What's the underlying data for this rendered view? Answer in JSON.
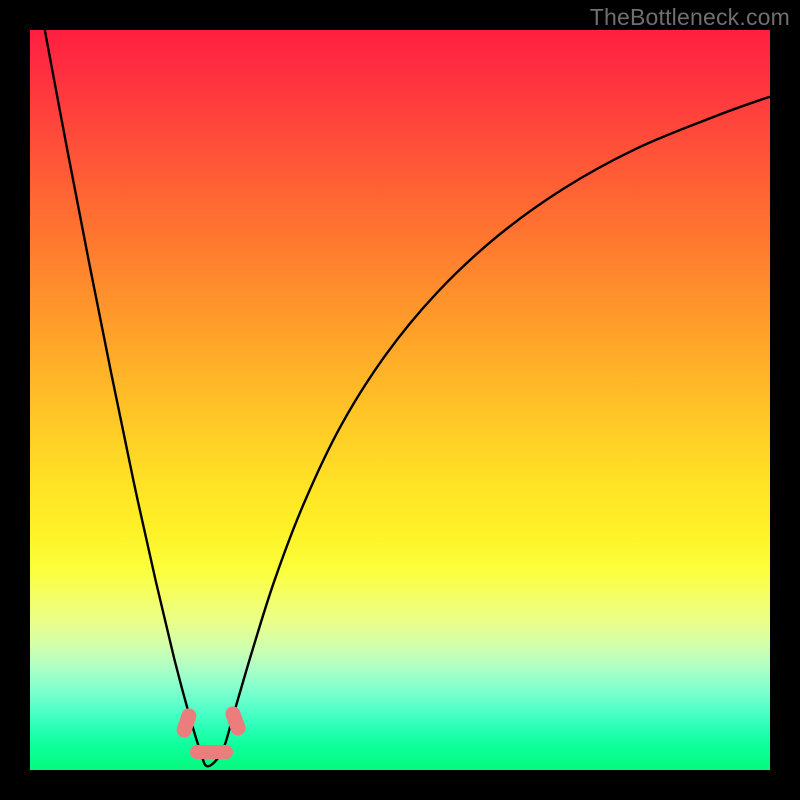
{
  "watermark": "TheBottleneck.com",
  "colors": {
    "frame": "#000000",
    "curve": "#000000",
    "blob": "#eb7d7d",
    "watermark": "#6f6f6f"
  },
  "chart_data": {
    "type": "line",
    "title": "",
    "xlabel": "",
    "ylabel": "",
    "xlim": [
      0,
      100
    ],
    "ylim": [
      0,
      100
    ],
    "grid": false,
    "legend": false,
    "note": "Bottleneck-style V curve. x = normalized hardware balance axis; y = bottleneck %. Minimum (optimal point) at x≈24. Curve values estimated from pixels.",
    "series": [
      {
        "name": "bottleneck-curve",
        "x": [
          2,
          5,
          8,
          11,
          14,
          17,
          19.5,
          21.5,
          23,
          24,
          26,
          27.5,
          30,
          33,
          37,
          42,
          48,
          55,
          63,
          72,
          82,
          93,
          100
        ],
        "y": [
          100,
          84,
          68.5,
          53.5,
          39,
          25.5,
          15,
          7.5,
          2.6,
          0.5,
          2.6,
          7.5,
          16,
          25.5,
          36,
          46.5,
          56,
          64.5,
          72,
          78.5,
          84,
          88.5,
          91
        ]
      }
    ],
    "markers": [
      {
        "name": "opt-region-center",
        "x": 24.5,
        "y": 0.5
      },
      {
        "name": "opt-region-left",
        "x": 22.0,
        "y": 3.5
      },
      {
        "name": "opt-region-right",
        "x": 27.5,
        "y": 3.5
      }
    ]
  }
}
